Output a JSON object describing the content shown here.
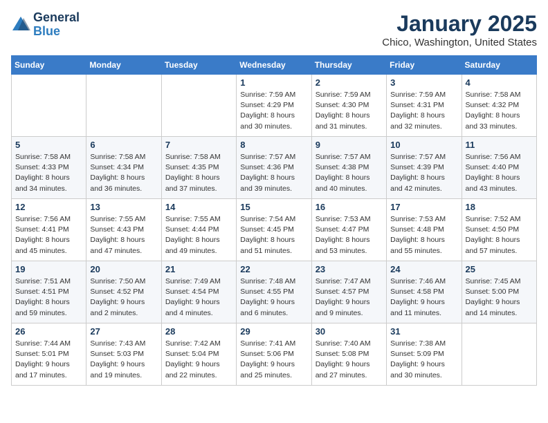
{
  "header": {
    "logo_general": "General",
    "logo_blue": "Blue",
    "month_title": "January 2025",
    "location": "Chico, Washington, United States"
  },
  "days_of_week": [
    "Sunday",
    "Monday",
    "Tuesday",
    "Wednesday",
    "Thursday",
    "Friday",
    "Saturday"
  ],
  "weeks": [
    [
      {
        "day": "",
        "details": ""
      },
      {
        "day": "",
        "details": ""
      },
      {
        "day": "",
        "details": ""
      },
      {
        "day": "1",
        "details": "Sunrise: 7:59 AM\nSunset: 4:29 PM\nDaylight: 8 hours\nand 30 minutes."
      },
      {
        "day": "2",
        "details": "Sunrise: 7:59 AM\nSunset: 4:30 PM\nDaylight: 8 hours\nand 31 minutes."
      },
      {
        "day": "3",
        "details": "Sunrise: 7:59 AM\nSunset: 4:31 PM\nDaylight: 8 hours\nand 32 minutes."
      },
      {
        "day": "4",
        "details": "Sunrise: 7:58 AM\nSunset: 4:32 PM\nDaylight: 8 hours\nand 33 minutes."
      }
    ],
    [
      {
        "day": "5",
        "details": "Sunrise: 7:58 AM\nSunset: 4:33 PM\nDaylight: 8 hours\nand 34 minutes."
      },
      {
        "day": "6",
        "details": "Sunrise: 7:58 AM\nSunset: 4:34 PM\nDaylight: 8 hours\nand 36 minutes."
      },
      {
        "day": "7",
        "details": "Sunrise: 7:58 AM\nSunset: 4:35 PM\nDaylight: 8 hours\nand 37 minutes."
      },
      {
        "day": "8",
        "details": "Sunrise: 7:57 AM\nSunset: 4:36 PM\nDaylight: 8 hours\nand 39 minutes."
      },
      {
        "day": "9",
        "details": "Sunrise: 7:57 AM\nSunset: 4:38 PM\nDaylight: 8 hours\nand 40 minutes."
      },
      {
        "day": "10",
        "details": "Sunrise: 7:57 AM\nSunset: 4:39 PM\nDaylight: 8 hours\nand 42 minutes."
      },
      {
        "day": "11",
        "details": "Sunrise: 7:56 AM\nSunset: 4:40 PM\nDaylight: 8 hours\nand 43 minutes."
      }
    ],
    [
      {
        "day": "12",
        "details": "Sunrise: 7:56 AM\nSunset: 4:41 PM\nDaylight: 8 hours\nand 45 minutes."
      },
      {
        "day": "13",
        "details": "Sunrise: 7:55 AM\nSunset: 4:43 PM\nDaylight: 8 hours\nand 47 minutes."
      },
      {
        "day": "14",
        "details": "Sunrise: 7:55 AM\nSunset: 4:44 PM\nDaylight: 8 hours\nand 49 minutes."
      },
      {
        "day": "15",
        "details": "Sunrise: 7:54 AM\nSunset: 4:45 PM\nDaylight: 8 hours\nand 51 minutes."
      },
      {
        "day": "16",
        "details": "Sunrise: 7:53 AM\nSunset: 4:47 PM\nDaylight: 8 hours\nand 53 minutes."
      },
      {
        "day": "17",
        "details": "Sunrise: 7:53 AM\nSunset: 4:48 PM\nDaylight: 8 hours\nand 55 minutes."
      },
      {
        "day": "18",
        "details": "Sunrise: 7:52 AM\nSunset: 4:50 PM\nDaylight: 8 hours\nand 57 minutes."
      }
    ],
    [
      {
        "day": "19",
        "details": "Sunrise: 7:51 AM\nSunset: 4:51 PM\nDaylight: 8 hours\nand 59 minutes."
      },
      {
        "day": "20",
        "details": "Sunrise: 7:50 AM\nSunset: 4:52 PM\nDaylight: 9 hours\nand 2 minutes."
      },
      {
        "day": "21",
        "details": "Sunrise: 7:49 AM\nSunset: 4:54 PM\nDaylight: 9 hours\nand 4 minutes."
      },
      {
        "day": "22",
        "details": "Sunrise: 7:48 AM\nSunset: 4:55 PM\nDaylight: 9 hours\nand 6 minutes."
      },
      {
        "day": "23",
        "details": "Sunrise: 7:47 AM\nSunset: 4:57 PM\nDaylight: 9 hours\nand 9 minutes."
      },
      {
        "day": "24",
        "details": "Sunrise: 7:46 AM\nSunset: 4:58 PM\nDaylight: 9 hours\nand 11 minutes."
      },
      {
        "day": "25",
        "details": "Sunrise: 7:45 AM\nSunset: 5:00 PM\nDaylight: 9 hours\nand 14 minutes."
      }
    ],
    [
      {
        "day": "26",
        "details": "Sunrise: 7:44 AM\nSunset: 5:01 PM\nDaylight: 9 hours\nand 17 minutes."
      },
      {
        "day": "27",
        "details": "Sunrise: 7:43 AM\nSunset: 5:03 PM\nDaylight: 9 hours\nand 19 minutes."
      },
      {
        "day": "28",
        "details": "Sunrise: 7:42 AM\nSunset: 5:04 PM\nDaylight: 9 hours\nand 22 minutes."
      },
      {
        "day": "29",
        "details": "Sunrise: 7:41 AM\nSunset: 5:06 PM\nDaylight: 9 hours\nand 25 minutes."
      },
      {
        "day": "30",
        "details": "Sunrise: 7:40 AM\nSunset: 5:08 PM\nDaylight: 9 hours\nand 27 minutes."
      },
      {
        "day": "31",
        "details": "Sunrise: 7:38 AM\nSunset: 5:09 PM\nDaylight: 9 hours\nand 30 minutes."
      },
      {
        "day": "",
        "details": ""
      }
    ]
  ]
}
